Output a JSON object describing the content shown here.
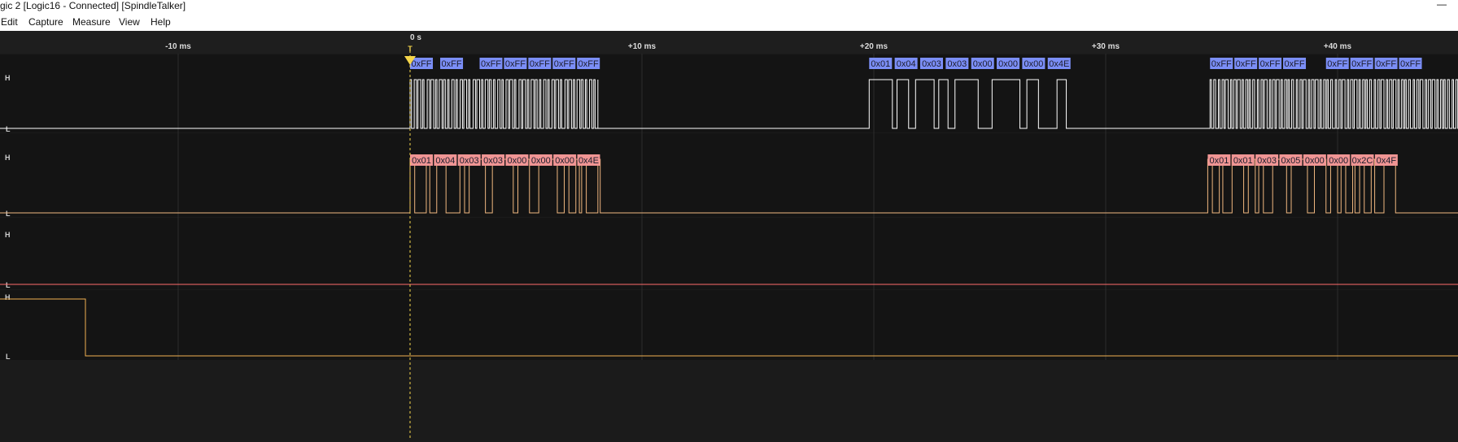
{
  "window": {
    "title": "gic 2 [Logic16 - Connected] [SpindleTalker]",
    "minimize_glyph": "—"
  },
  "menu": [
    "Edit",
    "Capture",
    "Measure",
    "View",
    "Help"
  ],
  "timeline": {
    "zero_label": "0 s",
    "trigger_label": "T",
    "ticks": [
      {
        "t": -10,
        "label": "-10 ms"
      },
      {
        "t": 10,
        "label": "+10 ms"
      },
      {
        "t": 20,
        "label": "+20 ms"
      },
      {
        "t": 30,
        "label": "+30 ms"
      },
      {
        "t": 40,
        "label": "+40 ms"
      }
    ]
  },
  "levels": {
    "high": "H",
    "low": "L"
  },
  "colors": {
    "background": "#1b1b1b",
    "lane": "#141414",
    "grid": "#2d2d2d",
    "channel0": "#ffffff",
    "channel1": "#f0b77f",
    "channel2": "#ff6b6b",
    "channel3": "#f2b152",
    "badge_blue": "#7b8ef7",
    "badge_pink": "#f09594",
    "trigger": "#f5d64b"
  },
  "channels": [
    {
      "id": "ch0",
      "color_key": "channel0",
      "bursts": [
        {
          "start": 0.0,
          "end": 8.1,
          "pulses": [
            0.06,
            0.12,
            0.1,
            0.06,
            0.12,
            0.08,
            0.06,
            0.14,
            0.1,
            0.06,
            0.12,
            0.08,
            0.06,
            0.1,
            0.12,
            0.06,
            0.08,
            0.1,
            0.06,
            0.12,
            0.1,
            0.08
          ]
        },
        {
          "start": 19.8,
          "end": 28.4,
          "pulses": [
            1.0,
            0.2,
            0.5,
            0.3,
            0.8,
            0.2,
            0.4,
            0.3,
            1.0,
            0.6,
            1.2,
            0.3,
            0.5,
            0.8,
            0.4,
            0.2,
            0.6,
            0.3,
            0.2,
            0.1,
            0.15,
            0.1
          ]
        },
        {
          "start": 34.5,
          "end": 45.2,
          "pulses": [
            0.06,
            0.1,
            0.08,
            0.12,
            0.06,
            0.1,
            0.08,
            0.06,
            0.12,
            0.1,
            0.06,
            0.08,
            0.1,
            0.06,
            0.12,
            0.08,
            0.06,
            0.1,
            0.08,
            0.06
          ]
        }
      ],
      "labels": [
        {
          "t": 0.0,
          "text": "0xFF"
        },
        {
          "t": 1.3,
          "text": "0xFF"
        },
        {
          "t": 3.0,
          "text": "0xFF"
        },
        {
          "t": 4.05,
          "text": "0xFF"
        },
        {
          "t": 5.1,
          "text": "0xFF"
        },
        {
          "t": 6.15,
          "text": "0xFF"
        },
        {
          "t": 7.2,
          "text": "0xFF"
        },
        {
          "t": 19.8,
          "text": "0x01"
        },
        {
          "t": 20.9,
          "text": "0x04"
        },
        {
          "t": 22.0,
          "text": "0x03"
        },
        {
          "t": 23.1,
          "text": "0x03"
        },
        {
          "t": 24.2,
          "text": "0x00"
        },
        {
          "t": 25.3,
          "text": "0x00"
        },
        {
          "t": 26.4,
          "text": "0x00"
        },
        {
          "t": 27.5,
          "text": "0x4E"
        },
        {
          "t": 34.5,
          "text": "0xFF"
        },
        {
          "t": 35.55,
          "text": "0xFF"
        },
        {
          "t": 36.6,
          "text": "0xFF"
        },
        {
          "t": 37.65,
          "text": "0xFF"
        },
        {
          "t": 39.5,
          "text": "0xFF"
        },
        {
          "t": 40.55,
          "text": "0xFF"
        },
        {
          "t": 41.6,
          "text": "0xFF"
        },
        {
          "t": 42.65,
          "text": "0xFF"
        }
      ]
    },
    {
      "id": "ch1",
      "color_key": "channel1",
      "bursts": [
        {
          "start": 0.0,
          "end": 8.2,
          "pulses": [
            0.2,
            0.5,
            0.15,
            0.3,
            0.4,
            0.6,
            0.2,
            0.2,
            0.7,
            0.3,
            0.9,
            0.2,
            0.5,
            0.4,
            0.8,
            0.3,
            0.2,
            0.3,
            0.15,
            0.1
          ]
        },
        {
          "start": 34.4,
          "end": 42.7,
          "pulses": [
            0.2,
            0.3,
            0.15,
            0.4,
            0.5,
            0.2,
            0.3,
            0.15,
            0.2,
            0.4,
            0.6,
            0.2,
            0.7,
            0.3,
            0.5,
            0.2,
            0.3,
            0.15,
            0.2,
            0.3,
            0.1,
            0.2
          ]
        }
      ],
      "labels": [
        {
          "t": 0.0,
          "text": "0x01"
        },
        {
          "t": 1.03,
          "text": "0x04"
        },
        {
          "t": 2.06,
          "text": "0x03"
        },
        {
          "t": 3.09,
          "text": "0x03"
        },
        {
          "t": 4.12,
          "text": "0x00"
        },
        {
          "t": 5.15,
          "text": "0x00"
        },
        {
          "t": 6.18,
          "text": "0x00"
        },
        {
          "t": 7.21,
          "text": "0x4E"
        },
        {
          "t": 34.4,
          "text": "0x01"
        },
        {
          "t": 35.43,
          "text": "0x01"
        },
        {
          "t": 36.46,
          "text": "0x03"
        },
        {
          "t": 37.49,
          "text": "0x05"
        },
        {
          "t": 38.52,
          "text": "0x00"
        },
        {
          "t": 39.55,
          "text": "0x00"
        },
        {
          "t": 40.58,
          "text": "0x2C"
        },
        {
          "t": 41.61,
          "text": "0x4F"
        }
      ]
    },
    {
      "id": "ch2",
      "color_key": "channel2",
      "bursts": [],
      "labels": []
    },
    {
      "id": "ch3",
      "color_key": "channel3",
      "initial_high_until": -14.0,
      "bursts": [],
      "labels": []
    }
  ]
}
